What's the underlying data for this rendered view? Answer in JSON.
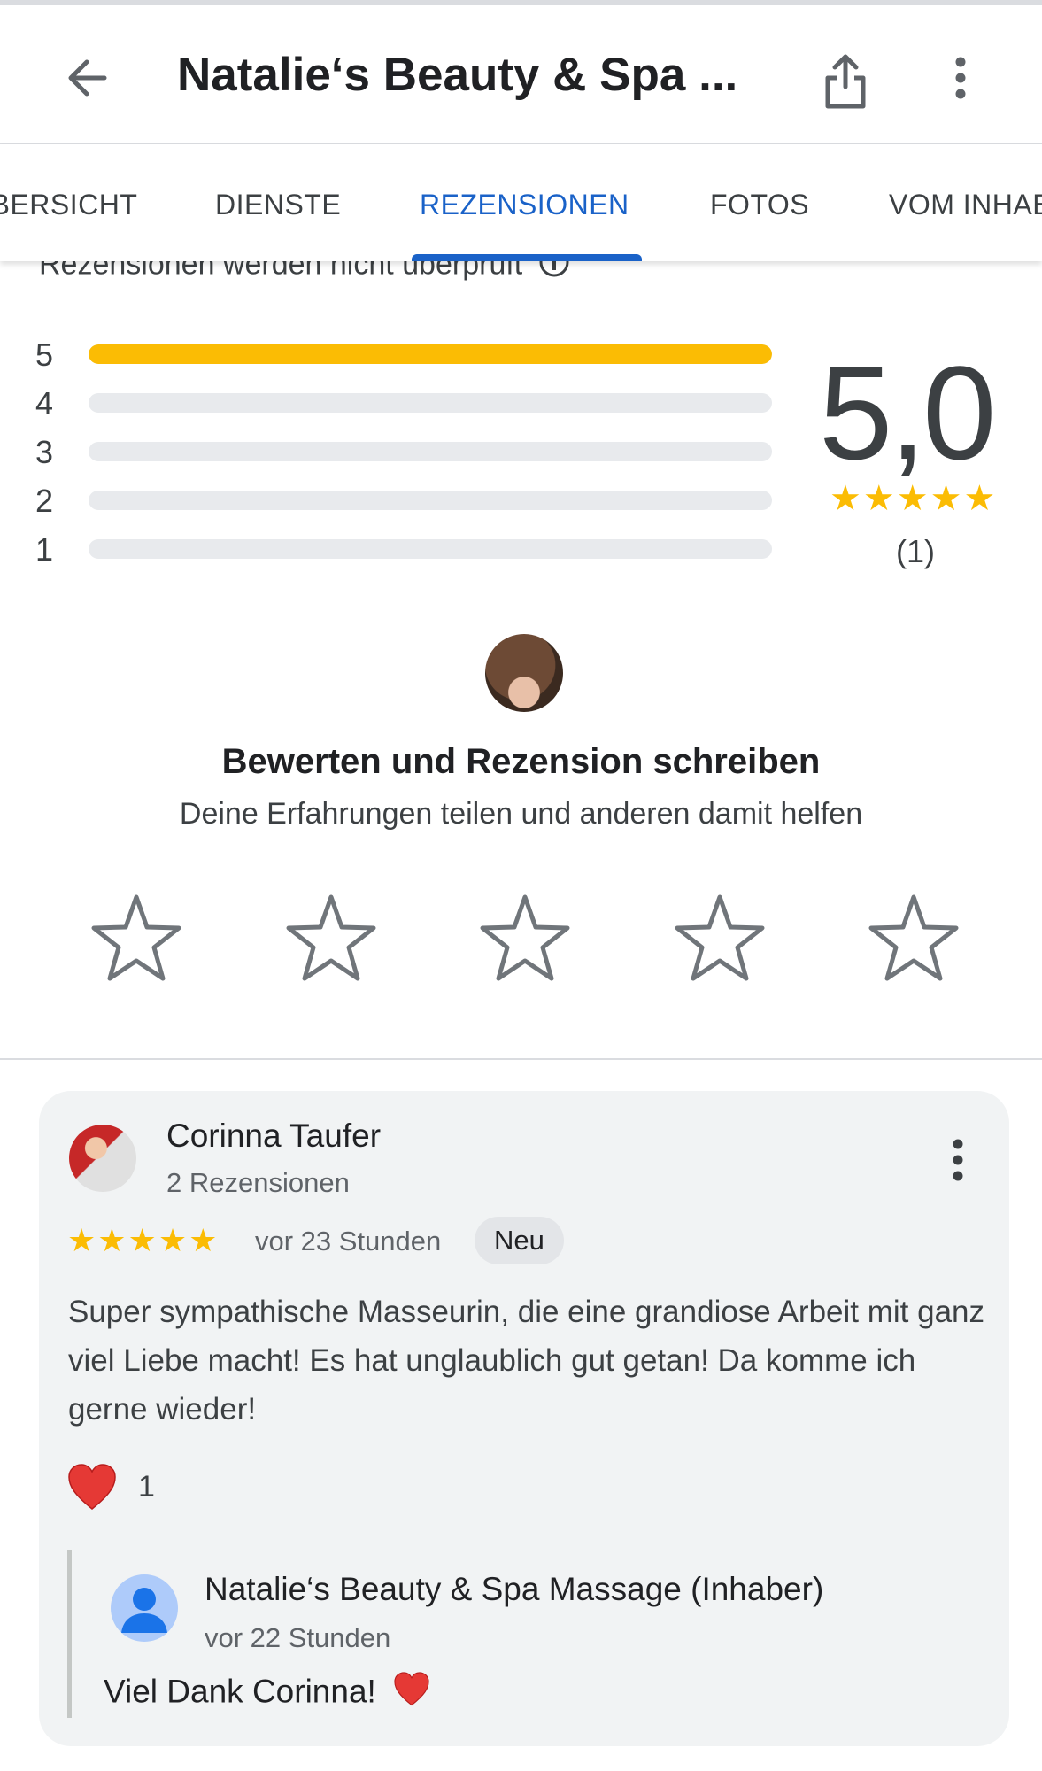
{
  "header": {
    "title": "Natalie‘s Beauty & Spa ..."
  },
  "tabs": [
    {
      "label": "ÜBERSICHT"
    },
    {
      "label": "DIENSTE"
    },
    {
      "label": "REZENSIONEN"
    },
    {
      "label": "FOTOS"
    },
    {
      "label": "VOM INHABER"
    }
  ],
  "active_tab": "REZENSIONEN",
  "notice": "Rezensionen werden nicht überprüft",
  "rating_distribution": [
    {
      "stars": "5",
      "fraction": 1.0
    },
    {
      "stars": "4",
      "fraction": 0.0
    },
    {
      "stars": "3",
      "fraction": 0.0
    },
    {
      "stars": "2",
      "fraction": 0.0
    },
    {
      "stars": "1",
      "fraction": 0.0
    }
  ],
  "summary": {
    "average": "5,0",
    "stars": "★★★★★",
    "count": "(1)"
  },
  "write_review": {
    "title": "Bewerten und Rezension schreiben",
    "subtitle": "Deine Erfahrungen teilen und anderen damit helfen"
  },
  "review": {
    "author": "Corinna Taufer",
    "author_reviews": "2 Rezensionen",
    "stars": "★★★★★",
    "time": "vor 23 Stunden",
    "badge": "Neu",
    "text": "Super sympathische Masseurin, die eine grandiose Arbeit mit ganz viel Liebe macht! Es hat unglaublich gut getan! Da komme ich gerne wieder!",
    "reaction_count": "1"
  },
  "owner_reply": {
    "name": "Natalie‘s Beauty & Spa Massage (Inhaber)",
    "time": "vor 22 Stunden",
    "text": "Viel Dank Corinna!"
  },
  "colors": {
    "accent": "#1a62c8",
    "star": "#fbbc04",
    "bar_empty": "#e8eaed",
    "card_bg": "#f1f3f4",
    "heart": "#e53935"
  },
  "icons": [
    "back-arrow-icon",
    "share-icon",
    "more-vert-icon",
    "info-icon",
    "star-outline-icon",
    "heart-icon",
    "person-icon"
  ]
}
